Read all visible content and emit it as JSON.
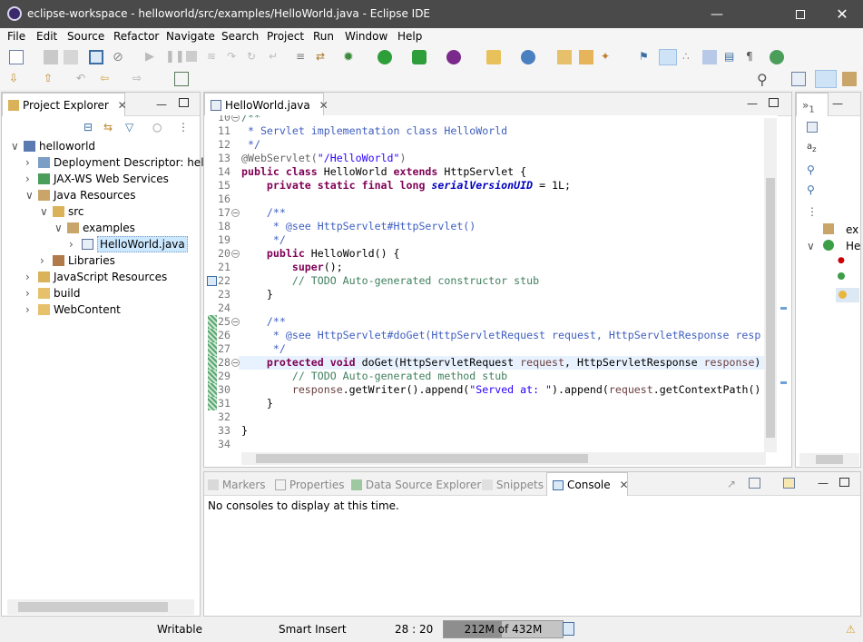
{
  "window": {
    "title": "eclipse-workspace - helloworld/src/examples/HelloWorld.java - Eclipse IDE"
  },
  "menu": [
    "File",
    "Edit",
    "Source",
    "Refactor",
    "Navigate",
    "Search",
    "Project",
    "Run",
    "Window",
    "Help"
  ],
  "project_explorer": {
    "title": "Project Explorer",
    "items": [
      {
        "label": "helloworld",
        "level": 0,
        "expanded": true,
        "icon": "project-icon"
      },
      {
        "label": "Deployment Descriptor: hello",
        "level": 1,
        "expanded": false,
        "icon": "deployment-icon"
      },
      {
        "label": "JAX-WS Web Services",
        "level": 1,
        "expanded": false,
        "icon": "webservice-icon"
      },
      {
        "label": "Java Resources",
        "level": 1,
        "expanded": true,
        "icon": "java-resources-icon"
      },
      {
        "label": "src",
        "level": 2,
        "expanded": true,
        "icon": "source-folder-icon"
      },
      {
        "label": "examples",
        "level": 3,
        "expanded": true,
        "icon": "package-icon"
      },
      {
        "label": "HelloWorld.java",
        "level": 4,
        "expanded": false,
        "icon": "java-file-icon",
        "selected": true
      },
      {
        "label": "Libraries",
        "level": 2,
        "expanded": false,
        "icon": "library-icon"
      },
      {
        "label": "JavaScript Resources",
        "level": 1,
        "expanded": false,
        "icon": "js-resources-icon"
      },
      {
        "label": "build",
        "level": 1,
        "expanded": false,
        "icon": "folder-icon"
      },
      {
        "label": "WebContent",
        "level": 1,
        "expanded": false,
        "icon": "folder-icon"
      }
    ]
  },
  "editor": {
    "tab": "HelloWorld.java",
    "lines": [
      {
        "n": "10",
        "fold": true,
        "tokens": [
          [
            "cm",
            "/**"
          ]
        ]
      },
      {
        "n": "11",
        "tokens": [
          [
            "jd",
            " * Servlet implementation class HelloWorld"
          ]
        ]
      },
      {
        "n": "12",
        "tokens": [
          [
            "jd",
            " */"
          ]
        ]
      },
      {
        "n": "13",
        "tokens": [
          [
            "an",
            "@WebServlet("
          ],
          [
            "st",
            "\"/HelloWorld\""
          ],
          [
            "an",
            ")"
          ]
        ]
      },
      {
        "n": "14",
        "tokens": [
          [
            "kw",
            "public class "
          ],
          [
            "",
            "HelloWorld "
          ],
          [
            "kw",
            "extends "
          ],
          [
            "",
            "HttpServlet {"
          ]
        ]
      },
      {
        "n": "15",
        "tokens": [
          [
            "",
            "    "
          ],
          [
            "kw",
            "private static final long "
          ],
          [
            "fi",
            "serialVersionUID"
          ],
          [
            "",
            " = 1L;"
          ]
        ]
      },
      {
        "n": "16",
        "tokens": []
      },
      {
        "n": "17",
        "fold": true,
        "tokens": [
          [
            "jd",
            "    /**"
          ]
        ]
      },
      {
        "n": "18",
        "tokens": [
          [
            "jd",
            "     * @see HttpServlet#HttpServlet()"
          ]
        ]
      },
      {
        "n": "19",
        "tokens": [
          [
            "jd",
            "     */"
          ]
        ]
      },
      {
        "n": "20",
        "fold": true,
        "tokens": [
          [
            "",
            "    "
          ],
          [
            "kw",
            "public "
          ],
          [
            "",
            "HelloWorld() {"
          ]
        ]
      },
      {
        "n": "21",
        "tokens": [
          [
            "",
            "        "
          ],
          [
            "kw",
            "super"
          ],
          [
            "",
            "();"
          ]
        ]
      },
      {
        "n": "22",
        "task": true,
        "tokens": [
          [
            "",
            "        "
          ],
          [
            "cm",
            "// TODO Auto-generated constructor stub"
          ]
        ]
      },
      {
        "n": "23",
        "tokens": [
          [
            "",
            "    }"
          ]
        ]
      },
      {
        "n": "24",
        "tokens": []
      },
      {
        "n": "25",
        "fold": true,
        "changed": true,
        "tokens": [
          [
            "jd",
            "    /**"
          ]
        ]
      },
      {
        "n": "26",
        "changed": true,
        "tokens": [
          [
            "jd",
            "     * @see HttpServlet#doGet(HttpServletRequest request, HttpServletResponse resp"
          ]
        ]
      },
      {
        "n": "27",
        "changed": true,
        "tokens": [
          [
            "jd",
            "     */"
          ]
        ]
      },
      {
        "n": "28",
        "fold": true,
        "changed": true,
        "current": true,
        "tokens": [
          [
            "",
            "    "
          ],
          [
            "kw",
            "protected void "
          ],
          [
            "",
            "doGet(HttpServletRequest "
          ],
          [
            "pa",
            "request"
          ],
          [
            "",
            ", HttpServletResponse "
          ],
          [
            "pa",
            "response"
          ],
          [
            "",
            ")"
          ]
        ]
      },
      {
        "n": "29",
        "changed": true,
        "tokens": [
          [
            "",
            "        "
          ],
          [
            "cm",
            "// TODO Auto-generated method stub"
          ]
        ]
      },
      {
        "n": "30",
        "changed": true,
        "tokens": [
          [
            "",
            "        "
          ],
          [
            "pa",
            "response"
          ],
          [
            "",
            ".getWriter().append("
          ],
          [
            "st",
            "\"Served at: \""
          ],
          [
            "",
            ").append("
          ],
          [
            "pa",
            "request"
          ],
          [
            "",
            ".getContextPath()"
          ]
        ]
      },
      {
        "n": "31",
        "changed": true,
        "tokens": [
          [
            "",
            "    }"
          ]
        ]
      },
      {
        "n": "32",
        "tokens": []
      },
      {
        "n": "33",
        "tokens": [
          [
            "",
            "}"
          ]
        ]
      },
      {
        "n": "34",
        "tokens": []
      }
    ]
  },
  "bottom_panel": {
    "tabs": [
      "Markers",
      "Properties",
      "Data Source Explorer",
      "Snippets",
      "Console"
    ],
    "active_tab": "Console",
    "message": "No consoles to display at this time."
  },
  "outline": {
    "items": [
      "ex",
      "He"
    ]
  },
  "status": {
    "writable": "Writable",
    "insert_mode": "Smart Insert",
    "position": "28 : 20",
    "heap": "212M of 432M",
    "heap_fraction": 0.49
  },
  "colors": {
    "titlebar": "#4a4a4a",
    "keyword": "#7f0055",
    "comment": "#3f7f5f",
    "javadoc": "#3f5fbf",
    "string": "#2a00ff",
    "selection": "#cce8ff"
  }
}
